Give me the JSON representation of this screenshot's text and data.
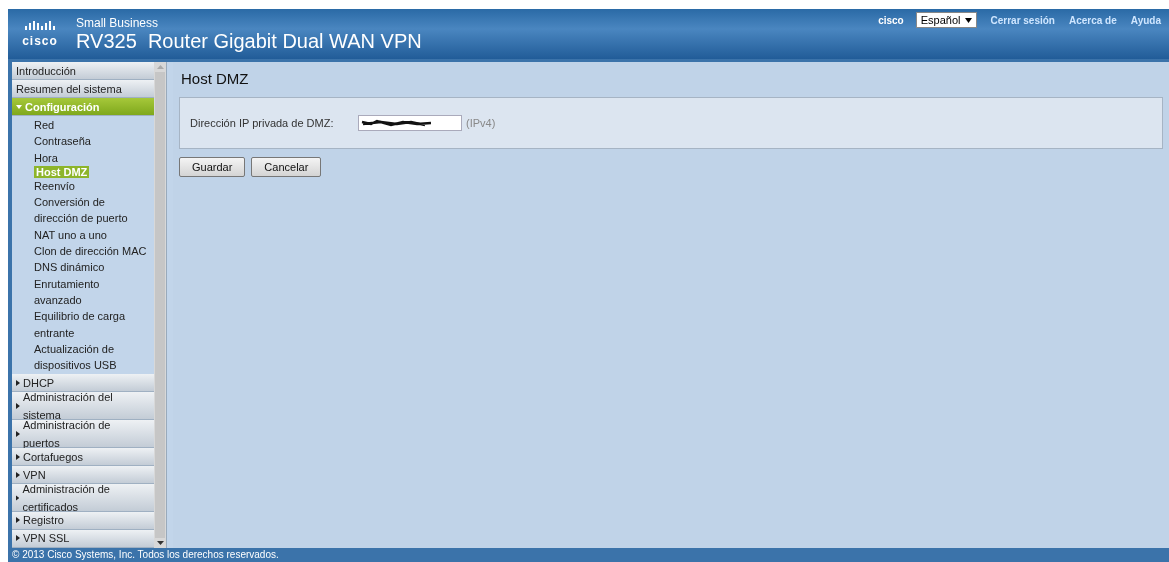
{
  "header": {
    "brand": "cisco",
    "tagline": "Small Business",
    "product": "RV325  Router Gigabit Dual WAN VPN",
    "user": "cisco",
    "language": "Español",
    "links": [
      "Cerrar sesión",
      "Acerca de",
      "Ayuda"
    ]
  },
  "sidebar": {
    "items": [
      {
        "label": "Introducción",
        "kind": "page",
        "selected": false
      },
      {
        "label": "Resumen del sistema",
        "kind": "page",
        "selected": false
      },
      {
        "label": "Configuración",
        "kind": "section",
        "expanded": true,
        "selected": false,
        "children": [
          {
            "label": "Red",
            "selected": false
          },
          {
            "label": "Contraseña",
            "selected": false
          },
          {
            "label": "Hora",
            "selected": false
          },
          {
            "label": "Host DMZ",
            "selected": true
          },
          {
            "label": "Reenvío",
            "selected": false
          },
          {
            "label": "Conversión de dirección de puerto",
            "selected": false
          },
          {
            "label": "NAT uno a uno",
            "selected": false
          },
          {
            "label": "Clon de dirección MAC",
            "selected": false
          },
          {
            "label": "DNS dinámico",
            "selected": false
          },
          {
            "label": "Enrutamiento avanzado",
            "selected": false
          },
          {
            "label": "Equilibrio de carga entrante",
            "selected": false
          },
          {
            "label": "Actualización de dispositivos USB",
            "selected": false
          }
        ]
      },
      {
        "label": "DHCP",
        "kind": "section",
        "expanded": false,
        "selected": false
      },
      {
        "label": "Administración del sistema",
        "kind": "section",
        "expanded": false,
        "selected": false
      },
      {
        "label": "Administración de puertos",
        "kind": "section",
        "expanded": false,
        "selected": false
      },
      {
        "label": "Cortafuegos",
        "kind": "section",
        "expanded": false,
        "selected": false
      },
      {
        "label": "VPN",
        "kind": "section",
        "expanded": false,
        "selected": false
      },
      {
        "label": "Administración de certificados",
        "kind": "section",
        "expanded": false,
        "selected": false
      },
      {
        "label": "Registro",
        "kind": "section",
        "expanded": false,
        "selected": false
      },
      {
        "label": "VPN SSL",
        "kind": "section",
        "expanded": false,
        "selected": false
      }
    ]
  },
  "content": {
    "title": "Host DMZ",
    "field": {
      "label": "Dirección IP privada de DMZ:",
      "hint": "(IPv4)",
      "redacted": true
    },
    "buttons": [
      "Guardar",
      "Cancelar"
    ]
  },
  "footer": "© 2013 Cisco Systems, Inc. Todos los derechos reservados."
}
